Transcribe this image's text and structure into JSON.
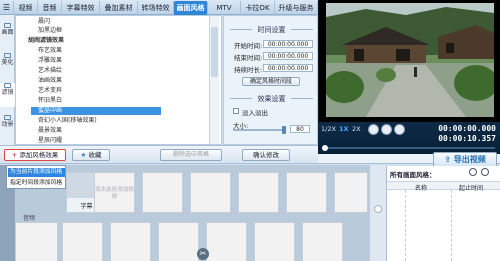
{
  "tabs": {
    "menu_icon": "menu-icon",
    "items": [
      "视频",
      "音频",
      "字幕特效",
      "叠加素材",
      "转场特效",
      "画面风格",
      "MTV",
      "卡拉OK",
      "升级与服务"
    ],
    "active": "画面风格"
  },
  "leftnav": [
    {
      "label": "画面",
      "icon": "picture-icon"
    },
    {
      "label": "美化",
      "icon": "beautify-icon"
    },
    {
      "label": "滤镜",
      "icon": "filter-icon"
    },
    {
      "label": "动景",
      "icon": "motion-icon"
    }
  ],
  "effect_list": {
    "items": [
      {
        "text": "晨闪",
        "kind": "item"
      },
      {
        "text": "加黑边框",
        "kind": "item"
      },
      {
        "text": "胡闹滤镜效果",
        "kind": "group"
      },
      {
        "text": "布艺效果",
        "kind": "item"
      },
      {
        "text": "浮雕效果",
        "kind": "item"
      },
      {
        "text": "艺术描绘",
        "kind": "item"
      },
      {
        "text": "油画效果",
        "kind": "item"
      },
      {
        "text": "艺术变异",
        "kind": "item"
      },
      {
        "text": "怀旧黑白",
        "kind": "item"
      },
      {
        "text": "蜜晶中画",
        "kind": "item"
      },
      {
        "text": "奇幻小人国(移轴效果)",
        "kind": "item"
      },
      {
        "text": "晨景效果",
        "kind": "item"
      },
      {
        "text": "星辰闪耀",
        "kind": "item"
      }
    ],
    "selected_index": 9
  },
  "settings": {
    "time_title": "时间设置",
    "start_label": "开始时间:",
    "start_value": "00:00:00.000",
    "end_label": "结束时间:",
    "end_value": "00:00:00.000",
    "duration_label": "持续时长:",
    "duration_value": "00:00:00.000",
    "confirm_time_button": "确定风格时间段",
    "effect_title": "效果设置",
    "fade_label": "淡入淡出",
    "size_label": "大小:",
    "size_value": "80",
    "confirm_button": "确认修改"
  },
  "toolbar": {
    "add_effect": "添加风格效果",
    "favorite": "收藏",
    "delete": "删除选中风格"
  },
  "context_menu": {
    "item1": "为当前片段添加风格",
    "item2": "指定时间段添加风格"
  },
  "player": {
    "speeds": [
      "1/2X",
      "1X",
      "2X"
    ],
    "selected_speed": "1X",
    "current_time": "00:00:00.000",
    "total_time": "00:00:10.357",
    "progress": 0.0
  },
  "export": {
    "label": "导出视频"
  },
  "timeline": {
    "clip_label": "字幕",
    "hint_text": "双击此处添加视频",
    "audio_label": "音频"
  },
  "style_list": {
    "title": "所有画面风格：",
    "col_name": "名称",
    "col_start": "起止时间"
  }
}
